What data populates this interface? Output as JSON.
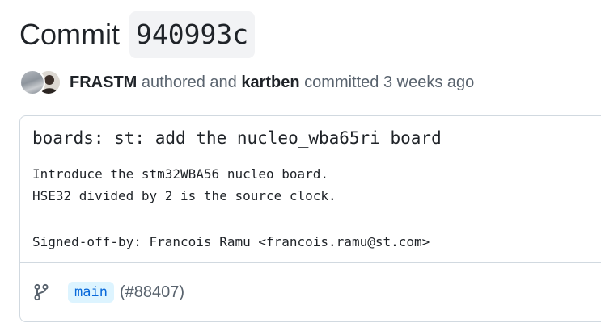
{
  "header": {
    "title": "Commit",
    "sha": "940993c"
  },
  "meta": {
    "author": "FRASTM",
    "authored_text": "authored and",
    "committer": "kartben",
    "committed_text": "committed",
    "time": "3 weeks ago"
  },
  "commit": {
    "headline": "boards: st: add the nucleo_wba65ri board",
    "body": [
      "Introduce the stm32WBA56 nucleo board.",
      "HSE32 divided by 2 is the source clock.",
      "",
      "Signed-off-by: Francois Ramu <francois.ramu@st.com>"
    ]
  },
  "footer": {
    "branch_icon": "git-branch-icon",
    "branch": "main",
    "pr_ref": "(#88407)"
  },
  "colors": {
    "text": "#1f2328",
    "muted": "#59636e",
    "border": "#d1d9e0",
    "branch_bg": "#ddf4ff",
    "branch_fg": "#0969da"
  }
}
